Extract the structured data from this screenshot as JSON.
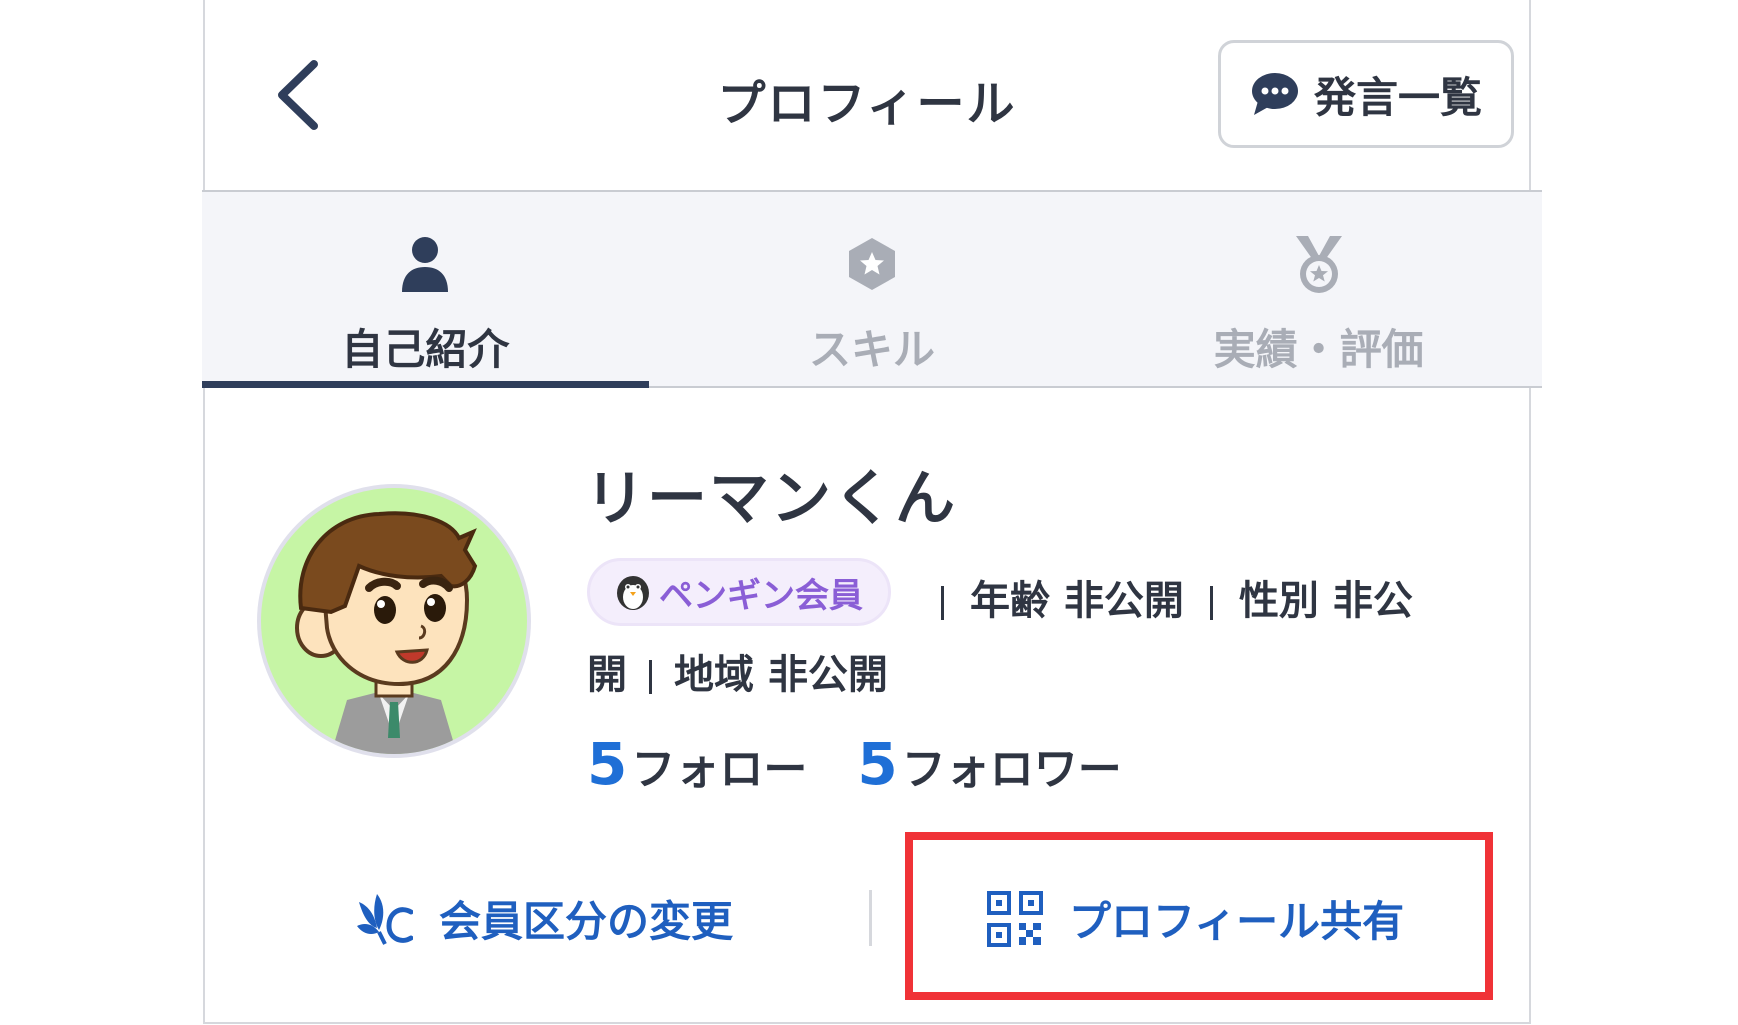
{
  "header": {
    "title": "プロフィール",
    "posts_button_label": "発言一覧"
  },
  "tabs": [
    {
      "label": "自己紹介",
      "icon": "person-icon",
      "active": true
    },
    {
      "label": "スキル",
      "icon": "star-hexagon-icon",
      "active": false
    },
    {
      "label": "実績・評価",
      "icon": "medal-icon",
      "active": false
    }
  ],
  "profile": {
    "name": "リーマンくん",
    "membership_badge": "ペンギン会員",
    "age_label": "年齢",
    "age_value": "非公開",
    "gender_label": "性別",
    "gender_value_part1": "非公",
    "gender_value_part2": "開",
    "region_label": "地域",
    "region_value": "非公開",
    "follow_count": "5",
    "follow_label": "フォロー",
    "follower_count": "5",
    "follower_label": "フォロワー"
  },
  "actions": {
    "change_membership": "会員区分の変更",
    "share_profile": "プロフィール共有"
  },
  "colors": {
    "accent_blue": "#1f6fd6",
    "action_blue": "#1f5fbf",
    "badge_purple": "#8a5ed6",
    "highlight_red": "#f03237",
    "tab_active_underline": "#2f3e5b"
  }
}
